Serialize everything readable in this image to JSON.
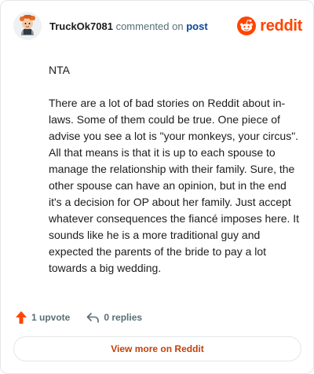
{
  "header": {
    "username": "TruckOk7081",
    "action_text": "commented on",
    "post_link": "post",
    "brand": "reddit"
  },
  "comment": {
    "paragraphs": [
      "NTA",
      "There are a lot of bad stories on Reddit about in-laws. Some of them could be true. One piece of advise you see a lot is \"your monkeys, your circus\". All that means is that it is up to each spouse to manage the relationship with their family. Sure, the other spouse can have an opinion, but in the end it's a decision for OP about her family. Just accept whatever consequences the fiancé imposes here. It sounds like he is a more traditional guy and expected the parents of the bride to pay a lot towards a big wedding."
    ]
  },
  "actions": {
    "upvotes_label": "1 upvote",
    "replies_label": "0 replies"
  },
  "footer": {
    "view_more_label": "View more on Reddit"
  },
  "colors": {
    "brand": "#ff4500",
    "upvote": "#ff4500",
    "link": "#0a449b",
    "muted": "#576f76"
  }
}
